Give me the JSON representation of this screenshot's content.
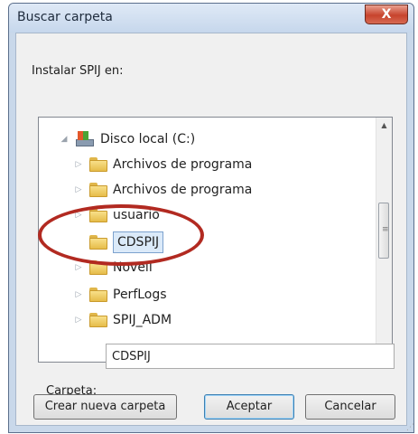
{
  "window": {
    "title": "Buscar carpeta",
    "close_glyph": "X"
  },
  "dialog": {
    "instruction": "Instalar SPIJ en:"
  },
  "tree": {
    "root": {
      "label": "Disco local (C:)",
      "icon": "drive-icon",
      "expander": "◢"
    },
    "items": [
      {
        "label": "Archivos de programa",
        "expander": "▷"
      },
      {
        "label": "Archivos de programa",
        "expander": "▷"
      },
      {
        "label": "usuario",
        "expander": "▷"
      },
      {
        "label": "CDSPIJ",
        "expander": "",
        "selected": true
      },
      {
        "label": "Novell",
        "expander": "▷"
      },
      {
        "label": "PerfLogs",
        "expander": "▷"
      },
      {
        "label": "SPIJ_ADM",
        "expander": "▷"
      }
    ],
    "scroll_up": "▲",
    "scroll_down": "▼",
    "grip": "≡"
  },
  "folder_field": {
    "label": "Carpeta:",
    "value": "CDSPIJ"
  },
  "buttons": {
    "new_folder": "Crear nueva carpeta",
    "ok": "Aceptar",
    "cancel": "Cancelar"
  },
  "annotation": {
    "color": "#b22a21"
  }
}
